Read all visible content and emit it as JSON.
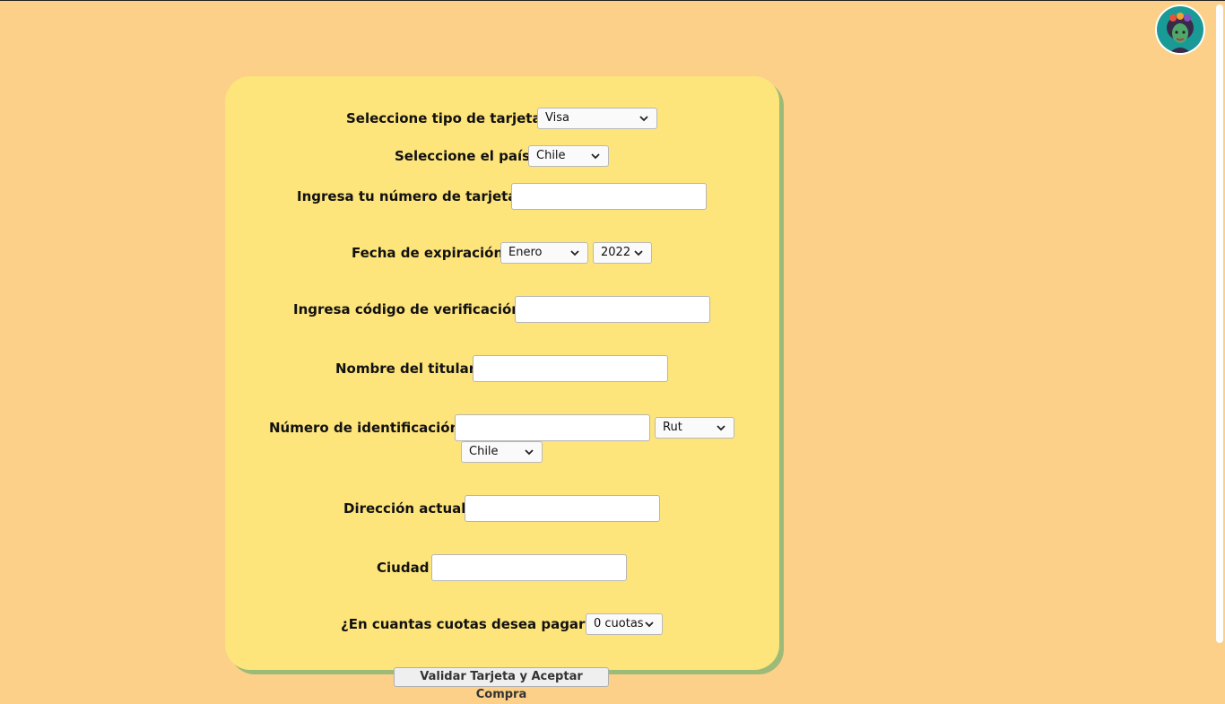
{
  "form": {
    "card_type": {
      "label": "Seleccione tipo de tarjeta",
      "value": "Visa"
    },
    "country": {
      "label": "Seleccione el país",
      "value": "Chile"
    },
    "card_number": {
      "label": "Ingresa tu número de tarjeta",
      "value": ""
    },
    "expiration": {
      "label": "Fecha de expiración",
      "month": "Enero",
      "year": "2022"
    },
    "cvv": {
      "label": "Ingresa código de verificación",
      "value": ""
    },
    "holder_name": {
      "label": "Nombre del titular",
      "value": ""
    },
    "id_number": {
      "label": "Número de identificación",
      "value": "",
      "id_type": "Rut",
      "id_country": "Chile"
    },
    "address": {
      "label": "Dirección actual",
      "value": ""
    },
    "city": {
      "label": "Ciudad",
      "value": ""
    },
    "installments": {
      "label": "¿En cuantas cuotas desea pagar?",
      "value": "0 cuotas"
    }
  },
  "submit_label": "Validar Tarjeta y Aceptar Compra",
  "colors": {
    "background": "#fcd088",
    "card": "#fde47b",
    "card_shadow": "#9dbb78",
    "avatar_bg": "#1a9a96"
  },
  "icons": {
    "avatar": "avatar-icon",
    "dropdown": "chevron-down-icon"
  }
}
